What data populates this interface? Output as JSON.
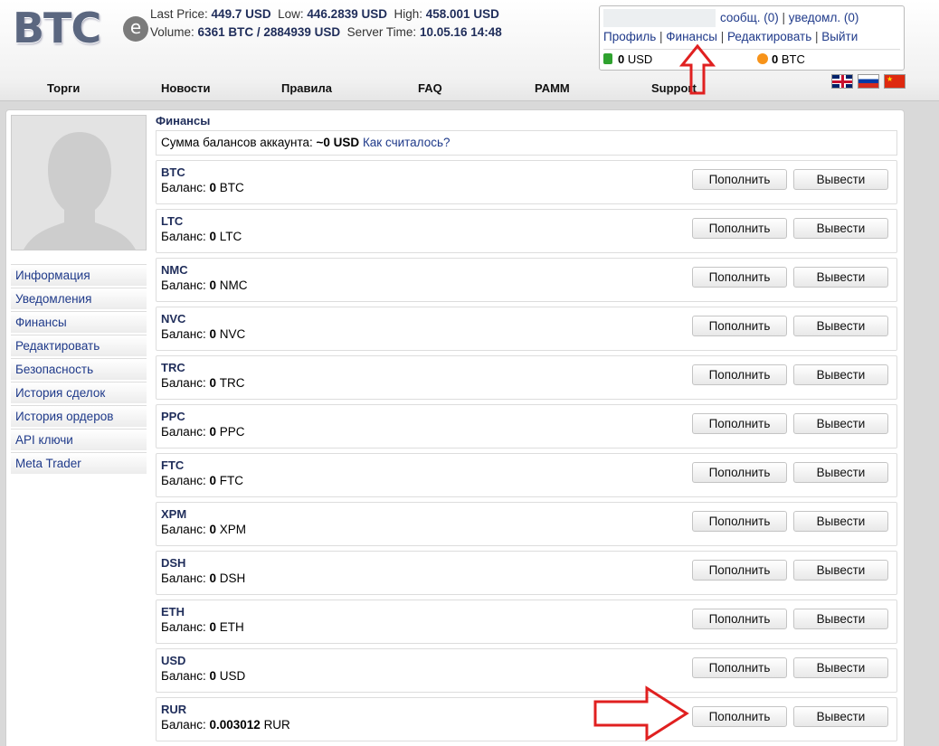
{
  "logo": {
    "text": "BTC",
    "badge": "e"
  },
  "ticker": {
    "last_price_label": "Last Price:",
    "last_price": "449.7 USD",
    "low_label": "Low:",
    "low": "446.2839 USD",
    "high_label": "High:",
    "high": "458.001 USD",
    "volume_label": "Volume:",
    "volume": "6361 BTC / 2884939 USD",
    "server_time_label": "Server Time:",
    "server_time": "10.05.16 14:48"
  },
  "userbox": {
    "messages_label": "сообщ.",
    "messages_count": "(0)",
    "notifications_label": "уведомл.",
    "notifications_count": "(0)",
    "links": [
      "Профиль",
      "Финансы",
      "Редактировать",
      "Выйти"
    ],
    "usd_balance": "0",
    "usd_unit": "USD",
    "btc_balance": "0",
    "btc_unit": "BTC"
  },
  "nav": [
    "Торги",
    "Новости",
    "Правила",
    "FAQ",
    "PAMM",
    "Support"
  ],
  "flags": [
    "flag-en-icon",
    "flag-ru-icon",
    "flag-cn-icon"
  ],
  "sidebar": [
    "Информация",
    "Уведомления",
    "Финансы",
    "Редактировать",
    "Безопасность",
    "История сделок",
    "История ордеров",
    "API ключи",
    "Meta Trader"
  ],
  "main": {
    "title": "Финансы",
    "total_label": "Сумма балансов аккаунта:",
    "total_value": "~0 USD",
    "total_link": "Как считалось?",
    "balance_label": "Баланс:",
    "deposit_label": "Пополнить",
    "withdraw_label": "Вывести",
    "currencies": [
      {
        "code": "BTC",
        "balance": "0",
        "unit": "BTC"
      },
      {
        "code": "LTC",
        "balance": "0",
        "unit": "LTC"
      },
      {
        "code": "NMC",
        "balance": "0",
        "unit": "NMC"
      },
      {
        "code": "NVC",
        "balance": "0",
        "unit": "NVC"
      },
      {
        "code": "TRC",
        "balance": "0",
        "unit": "TRC"
      },
      {
        "code": "PPC",
        "balance": "0",
        "unit": "PPC"
      },
      {
        "code": "FTC",
        "balance": "0",
        "unit": "FTC"
      },
      {
        "code": "XPM",
        "balance": "0",
        "unit": "XPM"
      },
      {
        "code": "DSH",
        "balance": "0",
        "unit": "DSH"
      },
      {
        "code": "ETH",
        "balance": "0",
        "unit": "ETH"
      },
      {
        "code": "USD",
        "balance": "0",
        "unit": "USD"
      },
      {
        "code": "RUR",
        "balance": "0.003012",
        "unit": "RUR"
      }
    ]
  },
  "colors": {
    "link": "#1f3a8a",
    "heading": "#1f2d5a",
    "annotation_arrow": "#e02020"
  }
}
